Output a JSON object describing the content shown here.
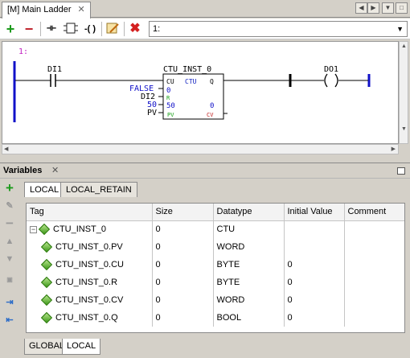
{
  "editor": {
    "tab_label": "[M] Main Ladder",
    "tab_close": "✕"
  },
  "toolbar": {
    "add_icon": "plus-icon",
    "remove_icon": "minus-icon",
    "rung_value": "1:"
  },
  "ladder": {
    "rung_number": "1:",
    "contact_label": "DI1",
    "block_name": "CTU_INST_0",
    "block_type": "CTU",
    "pin_cu": "CU",
    "pin_q": "Q",
    "pin_r": "R",
    "pin_pv": "PV",
    "pin_cv": "CV",
    "cu_value": "0",
    "in_false": "FALSE",
    "in_di2": "DI2",
    "in_50": "50",
    "in_pv": "PV",
    "r_value": "50",
    "cv_value": "0",
    "coil_label": "DO1"
  },
  "variables": {
    "title": "Variables",
    "tabs": [
      "LOCAL",
      "LOCAL_RETAIN"
    ],
    "bottom_tabs": [
      "GLOBAL",
      "LOCAL"
    ],
    "columns": [
      "Tag",
      "Size",
      "Datatype",
      "Initial Value",
      "Comment"
    ],
    "rows": [
      {
        "tag": "CTU_INST_0",
        "size": "0",
        "datatype": "CTU",
        "initial": "",
        "comment": ""
      },
      {
        "tag": "CTU_INST_0.PV",
        "size": "0",
        "datatype": "WORD",
        "initial": "",
        "comment": ""
      },
      {
        "tag": "CTU_INST_0.CU",
        "size": "0",
        "datatype": "BYTE",
        "initial": "0",
        "comment": ""
      },
      {
        "tag": "CTU_INST_0.R",
        "size": "0",
        "datatype": "BYTE",
        "initial": "0",
        "comment": ""
      },
      {
        "tag": "CTU_INST_0.CV",
        "size": "0",
        "datatype": "WORD",
        "initial": "0",
        "comment": ""
      },
      {
        "tag": "CTU_INST_0.Q",
        "size": "0",
        "datatype": "BOOL",
        "initial": "0",
        "comment": ""
      }
    ]
  }
}
